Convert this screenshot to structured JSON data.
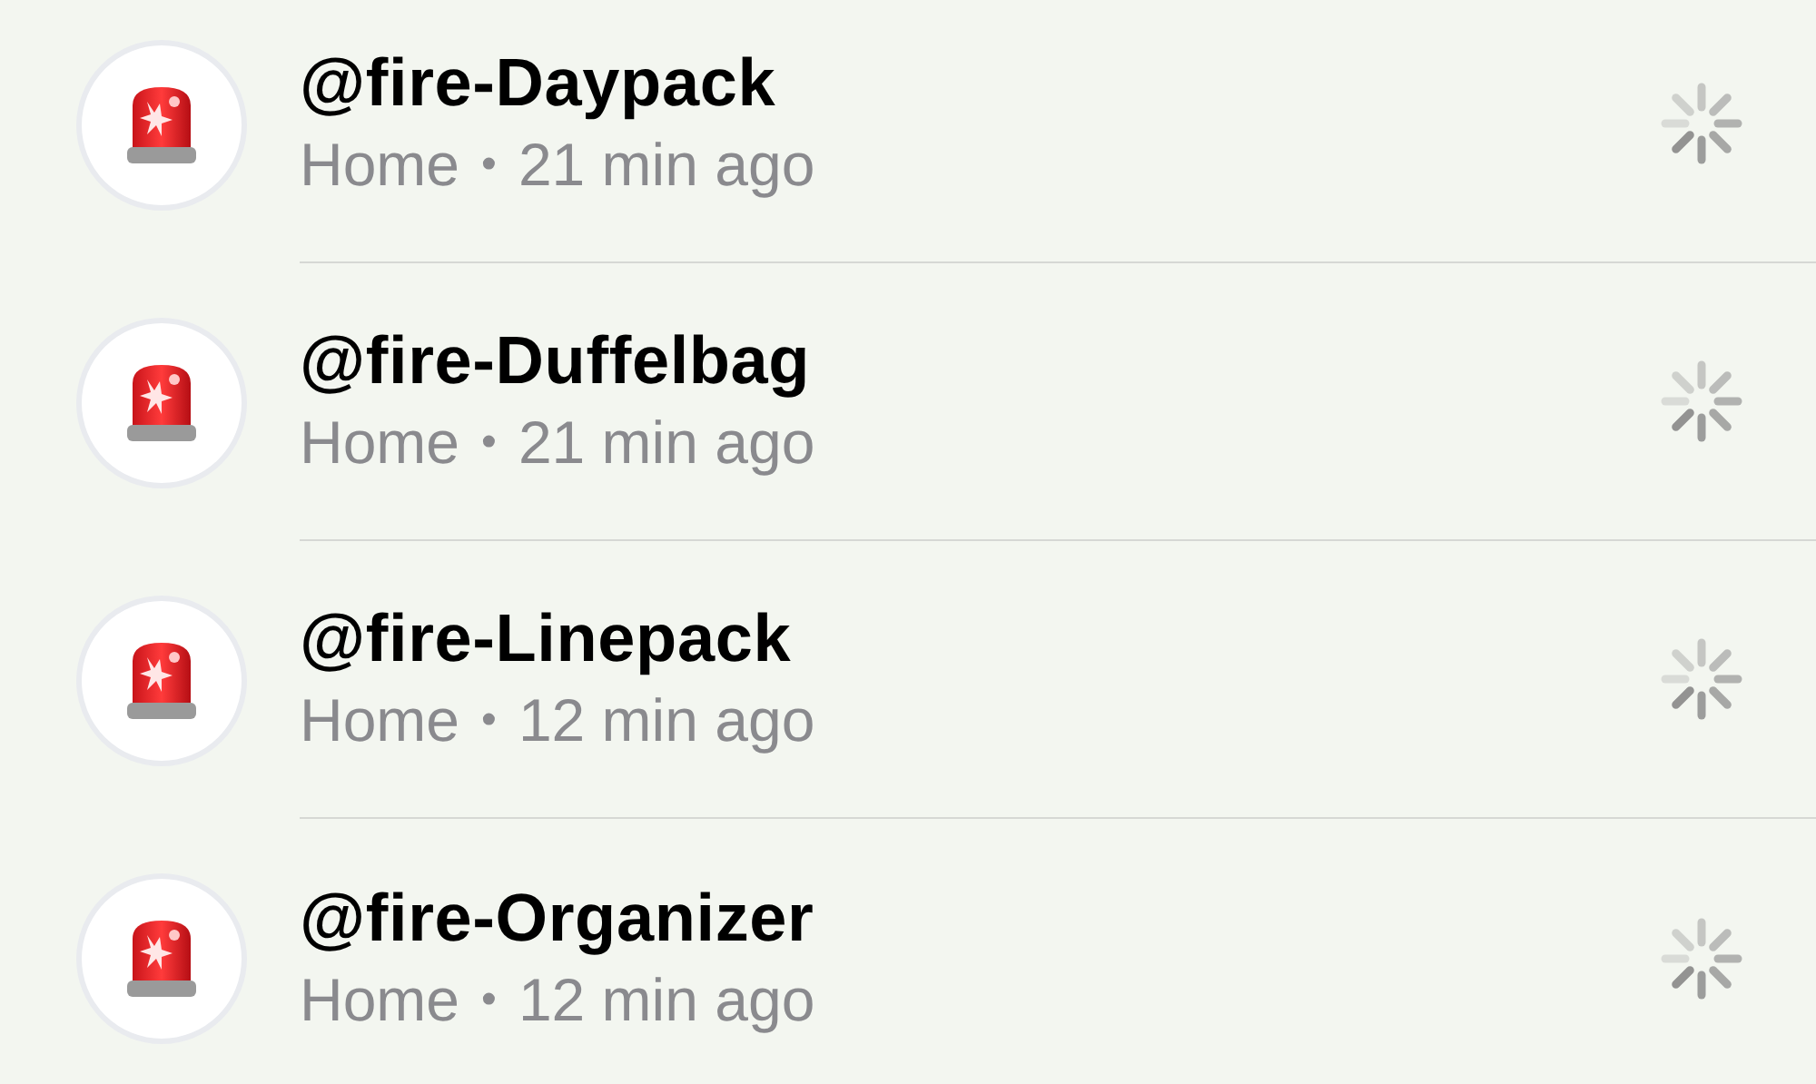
{
  "items": [
    {
      "name": "@fire-Daypack",
      "location": "Home",
      "separator": "•",
      "time": "21 min ago",
      "loading": true
    },
    {
      "name": "@fire-Duffelbag",
      "location": "Home",
      "separator": "•",
      "time": "21 min ago",
      "loading": true
    },
    {
      "name": "@fire-Linepack",
      "location": "Home",
      "separator": "•",
      "time": "12 min ago",
      "loading": true
    },
    {
      "name": "@fire-Organizer",
      "location": "Home",
      "separator": "•",
      "time": "12 min ago",
      "loading": true
    }
  ]
}
